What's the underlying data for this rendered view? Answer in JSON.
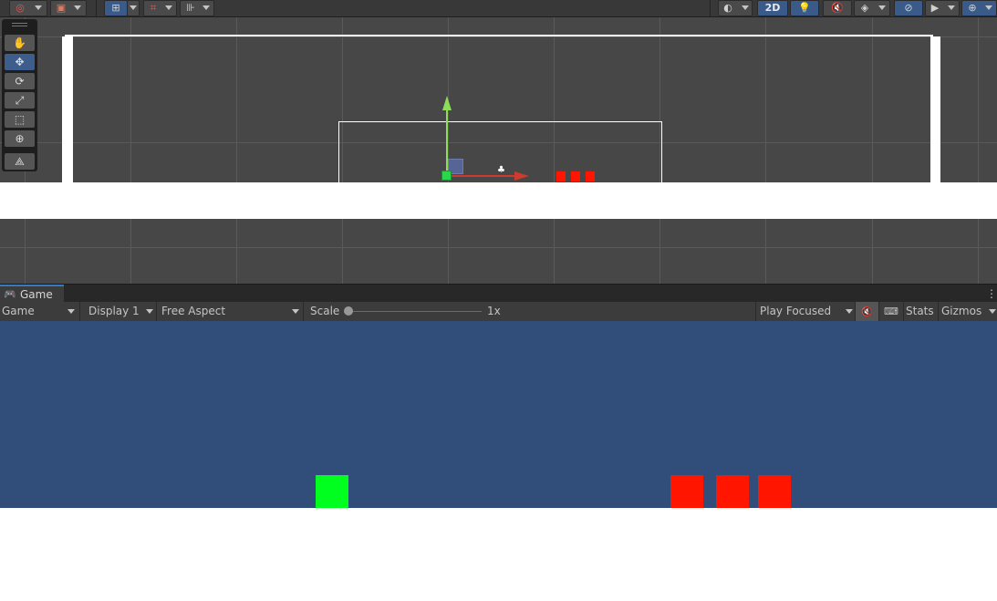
{
  "scene_toolbar": {
    "two_d_label": "2D",
    "icons": [
      "draw-mode-icon",
      "render-paths-icon",
      "transform-toggle-icon",
      "snap-icon",
      "grid-snap-icon",
      "shading-icon",
      "lighting-icon",
      "audio-mute-icon",
      "effects-icon",
      "visibility-icon",
      "camera-icon",
      "gizmos-icon"
    ]
  },
  "tool_palette": {
    "tools": [
      "hand-tool",
      "move-tool",
      "rotate-tool",
      "scale-tool",
      "rect-tool",
      "transform-tool",
      "custom-editor-tool"
    ],
    "active": "move-tool"
  },
  "game_panel": {
    "tab_label": "Game",
    "view_select": "Game",
    "display_select": "Display 1",
    "aspect_select": "Free Aspect",
    "scale_label": "Scale",
    "scale_value": "1x",
    "play_mode_select": "Play Focused",
    "stats_label": "Stats",
    "gizmos_label": "Gizmos"
  },
  "colors": {
    "scene_background": "#474747",
    "game_background": "#314d79",
    "player": "#00ff1e",
    "enemy": "#ff1500",
    "ground": "#ffffff",
    "accent": "#3a79bb"
  }
}
